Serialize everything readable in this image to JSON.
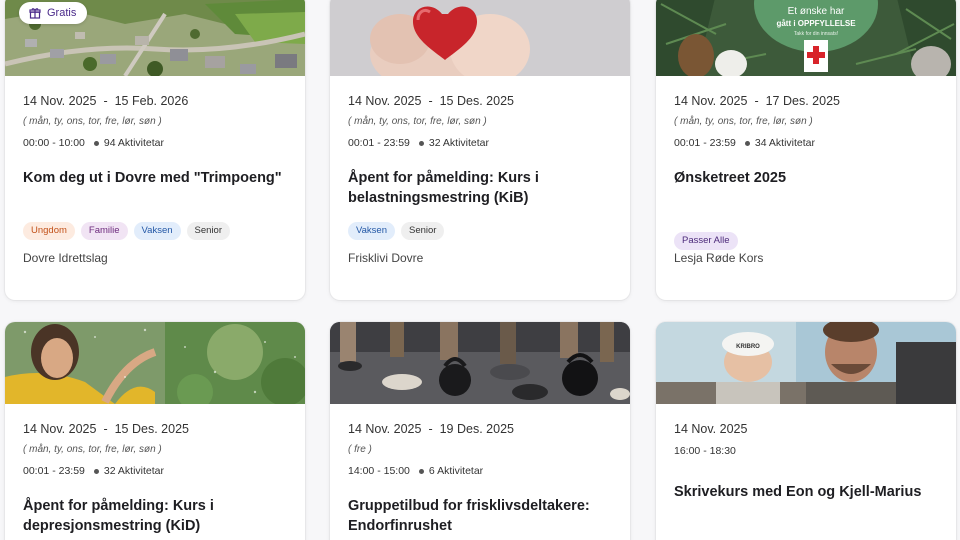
{
  "cards": [
    {
      "badge": "Gratis",
      "start": "14 Nov. 2025",
      "dash": "-",
      "end": "15 Feb. 2026",
      "days": "( mån, ty, ons, tor, fre, lør, søn )",
      "time": "00:00 - 10:00",
      "activities": "94 Aktivitetar",
      "title": "Kom deg ut i Dovre med \"Trimpoeng\"",
      "tags": [
        "Ungdom",
        "Familie",
        "Vaksen",
        "Senior"
      ],
      "organizer": "Dovre Idrettslag"
    },
    {
      "start": "14 Nov. 2025",
      "dash": "-",
      "end": "15 Des. 2025",
      "days": "( mån, ty, ons, tor, fre, lør, søn )",
      "time": "00:01 - 23:59",
      "activities": "32 Aktivitetar",
      "title": "Åpent for påmelding: Kurs i belastningsmestring (KiB)",
      "tags": [
        "Vaksen",
        "Senior"
      ],
      "organizer": "Frisklivi Dovre"
    },
    {
      "image_text": [
        "Et ønske har",
        "gått i OPPFYLLELSE",
        "Takk for din innsats!"
      ],
      "start": "14 Nov. 2025",
      "dash": "-",
      "end": "17 Des. 2025",
      "days": "( mån, ty, ons, tor, fre, lør, søn )",
      "time": "00:01 - 23:59",
      "activities": "34 Aktivitetar",
      "title": "Ønsketreet 2025",
      "tags": [
        "Passer Alle"
      ],
      "organizer": "Lesja Røde Kors"
    },
    {
      "start": "14 Nov. 2025",
      "dash": "-",
      "end": "15 Des. 2025",
      "days": "( mån, ty, ons, tor, fre, lør, søn )",
      "time": "00:01 - 23:59",
      "activities": "32 Aktivitetar",
      "title": "Åpent for påmelding: Kurs i depresjonsmestring (KiD)"
    },
    {
      "start": "14 Nov. 2025",
      "dash": "-",
      "end": "19 Des. 2025",
      "days": "( fre )",
      "time": "14:00 - 15:00",
      "activities": "6 Aktivitetar",
      "title": "Gruppetilbud for frisklivsdeltakere: Endorfinrushet"
    },
    {
      "image_text": [
        "KRIBRO"
      ],
      "start": "14 Nov. 2025",
      "time": "16:00 - 18:30",
      "title": "Skrivekurs med Eon og Kjell-Marius"
    }
  ],
  "colors": {
    "accent": "#4a2a8a",
    "page_bg": "#f7f7f9",
    "card_bg": "#ffffff"
  },
  "icons": {
    "badge": "gift-icon"
  }
}
